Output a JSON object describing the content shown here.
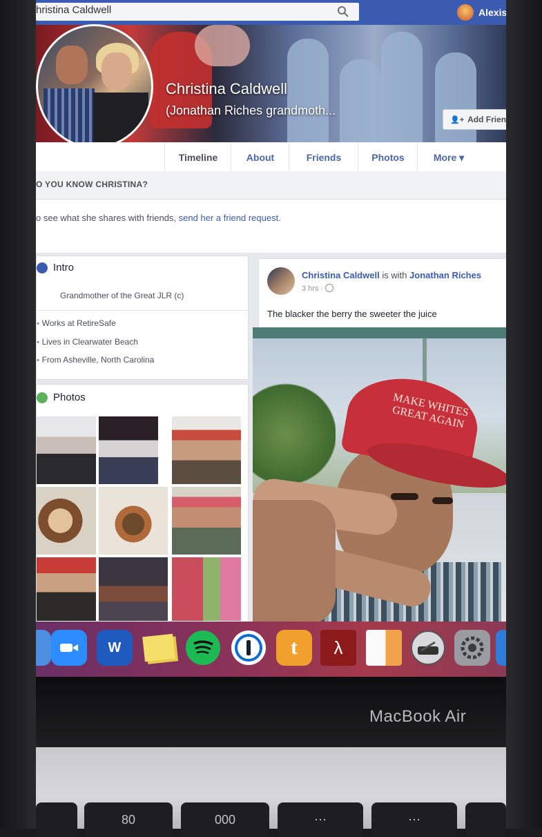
{
  "topbar": {
    "search_value": "hristina Caldwell",
    "account_name": "Alexis"
  },
  "profile": {
    "name": "Christina Caldwell",
    "subtitle": "(Jonathan Riches grandmoth...",
    "add_friend_label": "Add Frien"
  },
  "tabs": [
    {
      "label": "Timeline"
    },
    {
      "label": "About"
    },
    {
      "label": "Friends"
    },
    {
      "label": "Photos"
    },
    {
      "label": "More ▾"
    }
  ],
  "know": {
    "title": "O YOU KNOW CHRISTINA?",
    "text": "o see what she shares with friends, ",
    "link": "send her a friend request",
    "end": "."
  },
  "intro": {
    "title": "Intro",
    "bio": "Grandmother of the Great JLR (c)",
    "work": "Works at RetireSafe",
    "lives": "Lives in Clearwater Beach",
    "from": "From Asheville, North Carolina"
  },
  "photos_card": {
    "title": "Photos"
  },
  "post": {
    "author": "Christina Caldwell",
    "with_text": " is with ",
    "with_name": "Jonathan Riches",
    "time": "3 hrs ·",
    "text": "The blacker the berry the sweeter the juice",
    "hat_line1": "MAKE WHITES",
    "hat_line2": "GREAT AGAIN"
  },
  "dock": {
    "icons": [
      "finder-partial",
      "zoom",
      "word",
      "stickies",
      "spotify",
      "1password",
      "tumblr",
      "acrobat",
      "calendar-app",
      "disk-utility",
      "system-preferences"
    ]
  },
  "laptop": {
    "brand": "MacBook Air",
    "keys": [
      "80",
      "000"
    ]
  },
  "colors": {
    "facebook_blue": "#3b5bb0",
    "hat_red": "#c7303a"
  }
}
